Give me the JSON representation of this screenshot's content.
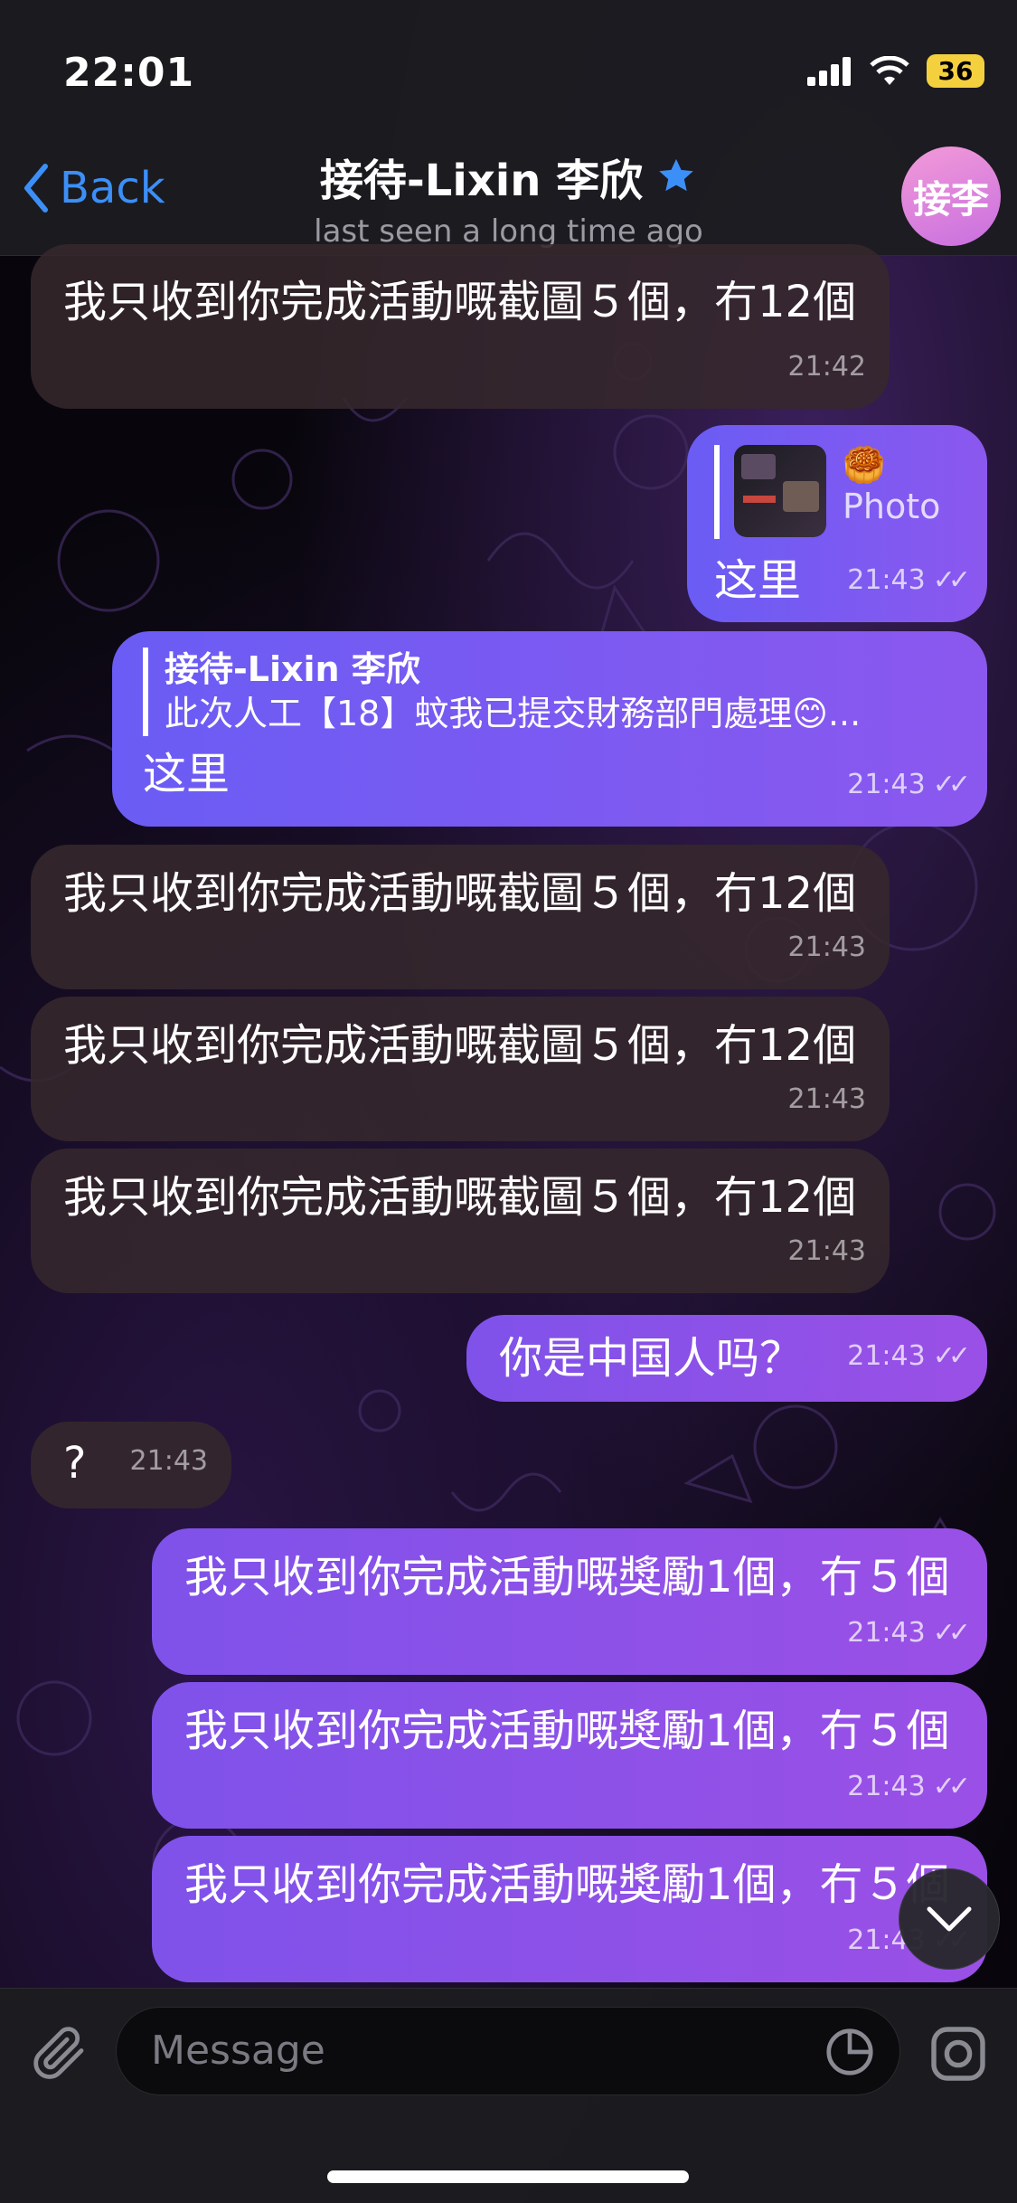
{
  "status_bar": {
    "time": "22:01",
    "battery": "36"
  },
  "header": {
    "back_label": "Back",
    "title": "接待-Lixin 李欣",
    "subtitle": "last seen a long time ago",
    "avatar_initials": "接李"
  },
  "messages": [
    {
      "direction": "in",
      "text": "我只收到你完成活動嘅截圖５個，冇12個",
      "time": "21:42"
    },
    {
      "direction": "out",
      "reply_type": "Photo",
      "reply_emoji": "🥮",
      "text": "这里",
      "time": "21:43",
      "read": true
    },
    {
      "direction": "out",
      "reply_name": "接待-Lixin 李欣",
      "reply_text": "此次人工【18】蚊我已提交財務部門處理😊...",
      "text": "这里",
      "time": "21:43",
      "read": true
    },
    {
      "direction": "in",
      "text": "我只收到你完成活動嘅截圖５個，冇12個",
      "time": "21:43"
    },
    {
      "direction": "in",
      "text": "我只收到你完成活動嘅截圖５個，冇12個",
      "time": "21:43"
    },
    {
      "direction": "in",
      "text": "我只收到你完成活動嘅截圖５個，冇12個",
      "time": "21:43"
    },
    {
      "direction": "out",
      "text": "你是中国人吗？",
      "time": "21:43",
      "read": true
    },
    {
      "direction": "in",
      "text": "?",
      "time": "21:43"
    },
    {
      "direction": "out",
      "text": "我只收到你完成活動嘅獎勵1個，冇５個",
      "time": "21:43",
      "read": true
    },
    {
      "direction": "out",
      "text": "我只收到你完成活動嘅獎勵1個，冇５個",
      "time": "21:43",
      "read": true
    },
    {
      "direction": "out",
      "text": "我只收到你完成活動嘅獎勵1個，冇５個",
      "time": "21:43",
      "read": true
    }
  ],
  "input": {
    "placeholder": "Message"
  },
  "colors": {
    "accent": "#3c8ff7",
    "outgoing": "#7b5af0",
    "incoming": "#36282c"
  },
  "icons": [
    "back-chevron-icon",
    "star-icon",
    "attach-icon",
    "sticker-icon",
    "camera-icon",
    "scroll-down-icon",
    "signal-icon",
    "wifi-icon"
  ]
}
